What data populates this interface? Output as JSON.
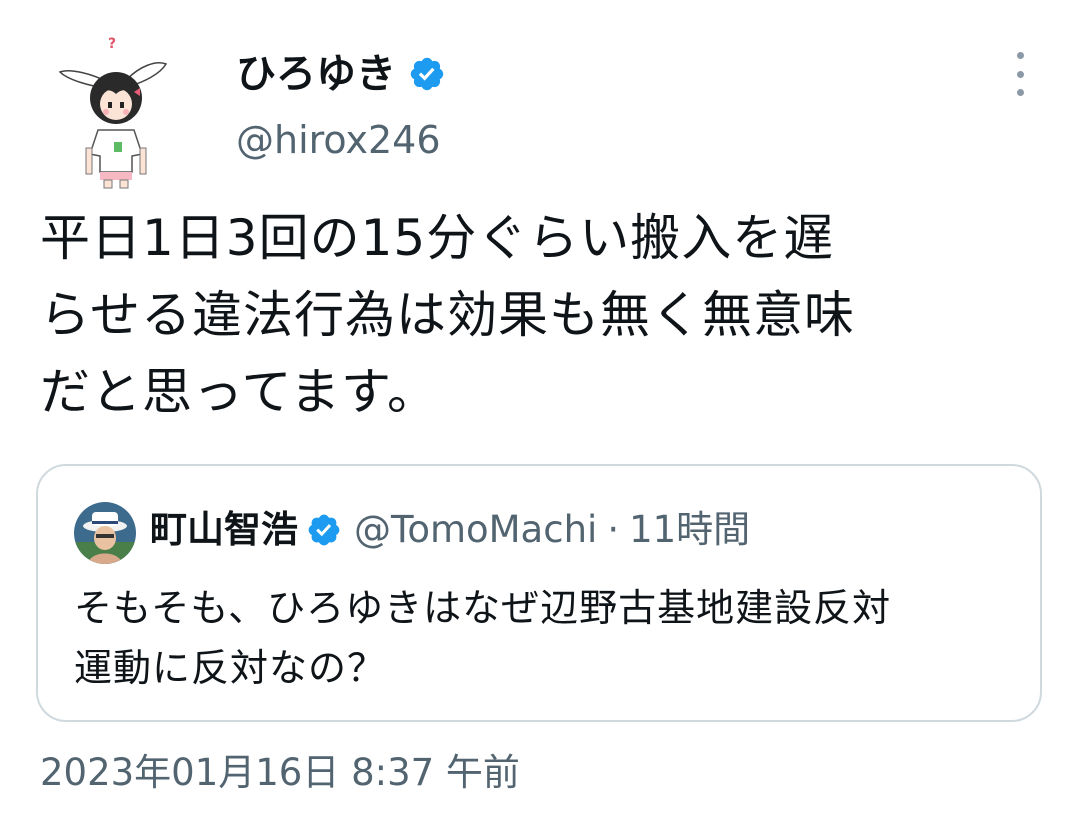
{
  "author": {
    "display_name": "ひろゆき",
    "handle": "@hirox246",
    "verified_icon": "verified-badge-icon",
    "avatar_icon": "bunny-ear-girl-avatar"
  },
  "tweet": {
    "text_lines": [
      "平日1日3回の15分ぐらい搬入を遅",
      "らせる違法行為は効果も無く無意味",
      "だと思ってます。"
    ],
    "timestamp": "2023年01月16日 8:37 午前"
  },
  "quote": {
    "display_name": "町山智浩",
    "handle": "@TomoMachi",
    "separator": "·",
    "time_ago": "11時間",
    "text_lines": [
      "そもそも、ひろゆきはなぜ辺野古基地建設反対",
      "運動に反対なの？"
    ]
  },
  "colors": {
    "verified_blue": "#1d9bf0",
    "secondary_text": "#536471",
    "primary_text": "#0f1419",
    "border": "#cfd9de"
  },
  "menu_icon": "more-vertical-icon"
}
